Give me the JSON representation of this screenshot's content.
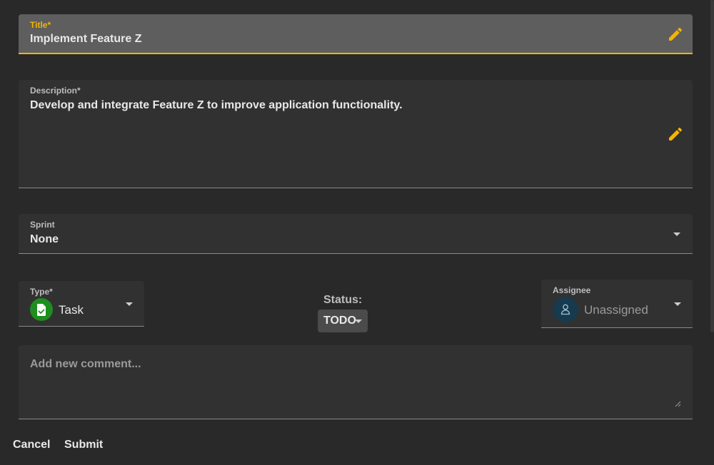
{
  "form": {
    "title": {
      "label": "Title*",
      "value": "Implement Feature Z"
    },
    "description": {
      "label": "Description*",
      "value": "Develop and integrate Feature Z to improve application functionality."
    },
    "sprint": {
      "label": "Sprint",
      "value": "None"
    },
    "type": {
      "label": "Type*",
      "value": "Task",
      "icon": "task-document-icon",
      "badge_color": "#1e8e1e"
    },
    "status": {
      "label": "Status:",
      "value": "TODO"
    },
    "assignee": {
      "label": "Assignee",
      "value": "Unassigned",
      "icon": "person-icon"
    },
    "comment": {
      "placeholder": "Add new comment..."
    }
  },
  "actions": {
    "cancel_label": "Cancel",
    "submit_label": "Submit"
  },
  "colors": {
    "accent": "#f4b400",
    "background": "#2a292a",
    "field_background": "#323132"
  }
}
